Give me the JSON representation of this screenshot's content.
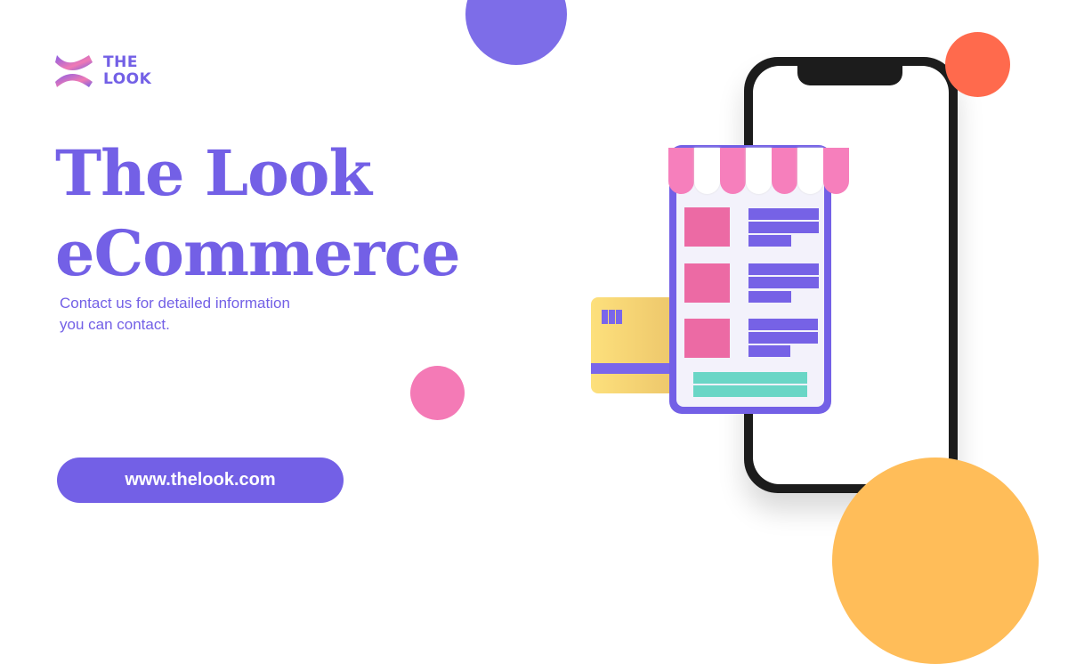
{
  "logo": {
    "line1": "THE",
    "line2": "LOOK"
  },
  "headline": {
    "line1": "The Look",
    "line2": "eCommerce"
  },
  "subtitle": {
    "line1": "Contact us for detailed information",
    "line2": "you can contact."
  },
  "cta": {
    "label": "www.thelook.com"
  },
  "colors": {
    "brand": "#7360e6",
    "pink": "#f47ab6",
    "orange": "#ff6a4d",
    "yellow": "#ffbd59"
  }
}
